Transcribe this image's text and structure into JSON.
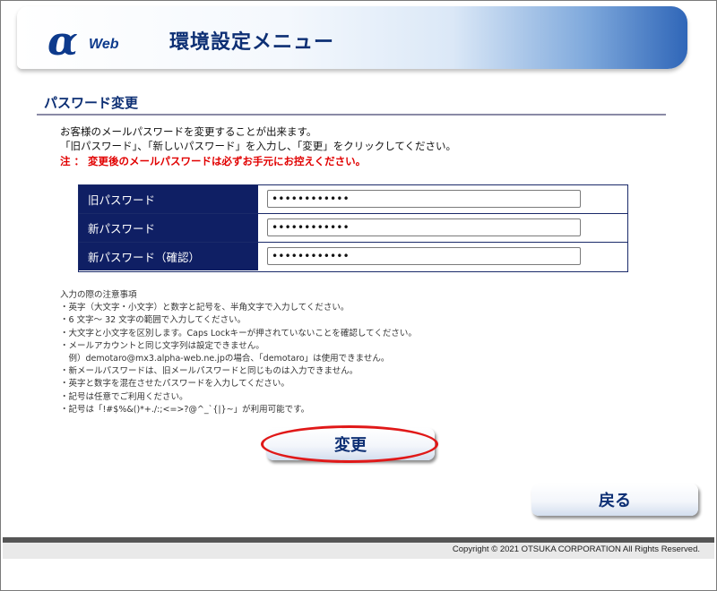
{
  "header": {
    "logo_mark": "α",
    "logo_text": "Web",
    "title": "環境設定メニュー"
  },
  "section": {
    "title": "パスワード変更"
  },
  "intro": {
    "line1": "お客様のメールパスワードを変更することが出来ます。",
    "line2": "「旧パスワード」、「新しいパスワード」を入力し、「変更」をクリックしてください。",
    "warning": "注 ： 変更後のメールパスワードは必ずお手元にお控えください。"
  },
  "form": {
    "fields": [
      {
        "label": "旧パスワード",
        "value": "••••••••••••"
      },
      {
        "label": "新パスワード",
        "value": "••••••••••••"
      },
      {
        "label": "新パスワード（確認）",
        "value": "••••••••••••"
      }
    ]
  },
  "notes": [
    "入力の際の注意事項",
    "・英字（大文字・小文字）と数字と記号を、半角文字で入力してください。",
    "・6 文字～ 32 文字の範囲で入力してください。",
    "・大文字と小文字を区別します。Caps Lockキーが押されていないことを確認してください。",
    "・メールアカウントと同じ文字列は設定できません。",
    "　例）demotaro@mx3.alpha-web.ne.jpの場合、「demotaro」は使用できません。",
    "・新メールパスワードは、旧メールパスワードと同じものは入力できません。",
    "・英字と数字を混在させたパスワードを入力してください。",
    "・記号は任意でご利用ください。",
    "・記号は「!#$%&()*+./:;<=>?@^_`{|}~」が利用可能です。"
  ],
  "buttons": {
    "submit": "変更",
    "back": "戻る"
  },
  "footer": {
    "copyright": "Copyright © 2021 OTSUKA CORPORATION All Rights Reserved."
  },
  "colors": {
    "navy": "#0f1f64",
    "title_blue": "#0d2f74",
    "warning_red": "#e10000",
    "highlight_oval": "#e01818"
  }
}
